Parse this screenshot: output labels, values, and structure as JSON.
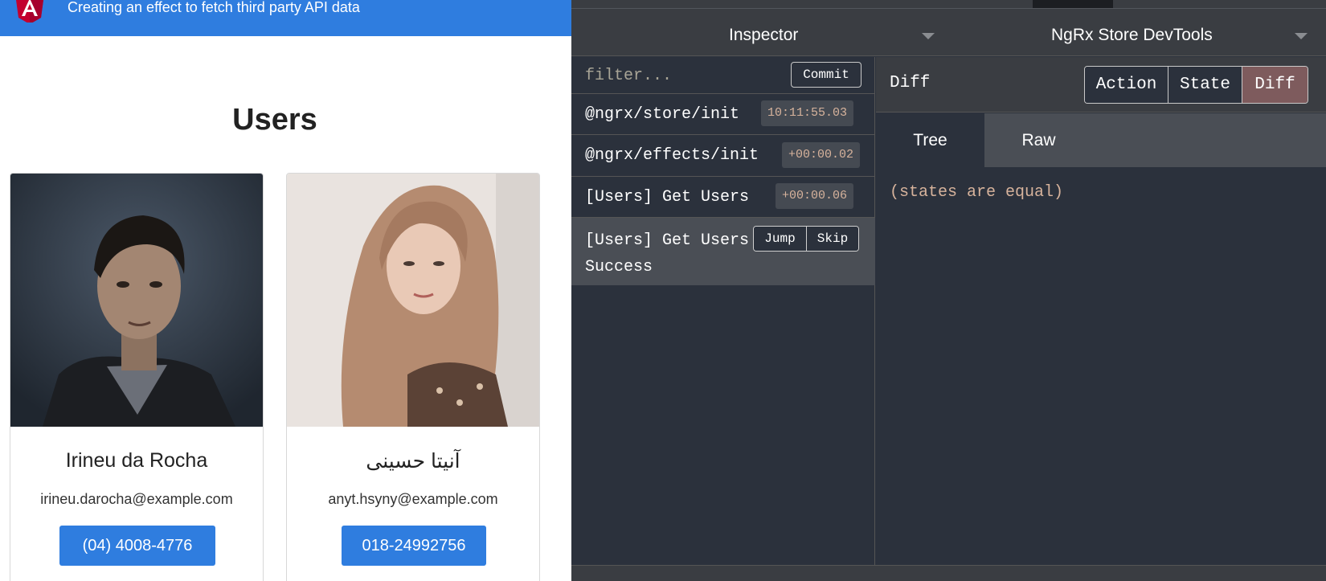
{
  "app": {
    "title": "Creating an effect to fetch third party API data",
    "logo_letter": "A",
    "heading": "Users",
    "brand_color": "#2f7ddf",
    "users": [
      {
        "name": "Irineu da Rocha",
        "email": "irineu.darocha@example.com",
        "phone": "(04) 4008-4776"
      },
      {
        "name": "آنیتا حسینی",
        "email": "anyt.hsyny@example.com",
        "phone": "018-24992756"
      }
    ]
  },
  "devtools": {
    "panel_select": "Inspector",
    "tool_select": "NgRx Store DevTools",
    "filter_placeholder": "filter...",
    "commit_label": "Commit",
    "actions": [
      {
        "name": "@ngrx/store/init",
        "time": "10:11:55.03"
      },
      {
        "name": "@ngrx/effects/init",
        "time": "+00:00.02"
      },
      {
        "name": "[Users] Get Users",
        "time": "+00:00.06"
      },
      {
        "name": "[Users] Get Users Success",
        "jump_label": "Jump",
        "skip_label": "Skip"
      }
    ],
    "pane_title": "Diff",
    "modes": [
      "Action",
      "State",
      "Diff"
    ],
    "active_mode": "Diff",
    "tabs": [
      "Tree",
      "Raw"
    ],
    "active_tab": "Tree",
    "diff_message": "(states are equal)"
  }
}
